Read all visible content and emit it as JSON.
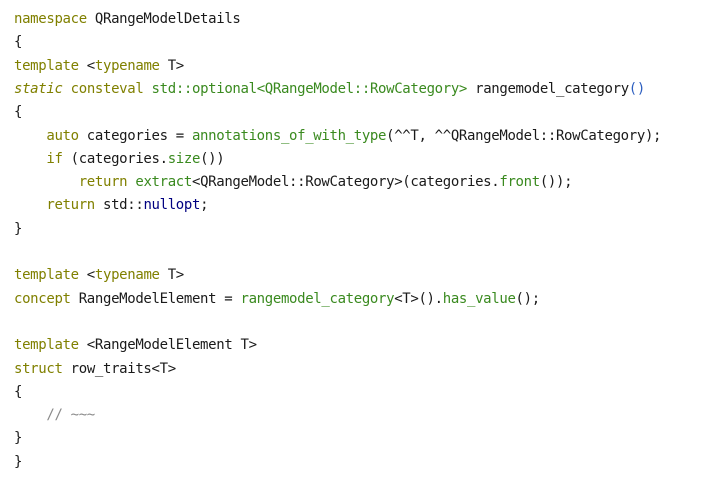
{
  "editor": {
    "background": "#ffffff",
    "colors": {
      "default_text": "#1a1a1a",
      "keyword": "#808000",
      "function_call": "#3a8a1f",
      "parentheses_highlight": "#2d5fc0",
      "constant": "#000080",
      "comment": "#8a8a8a"
    },
    "lines": [
      [
        {
          "t": "namespace",
          "c": "keyword"
        },
        {
          "t": " QRangeModelDetails"
        }
      ],
      [
        {
          "t": "{"
        }
      ],
      [
        {
          "t": "template",
          "c": "keyword"
        },
        {
          "t": " <"
        },
        {
          "t": "typename",
          "c": "keyword"
        },
        {
          "t": " T>"
        }
      ],
      [
        {
          "t": "static",
          "c": "keyword italic"
        },
        {
          "t": " "
        },
        {
          "t": "consteval",
          "c": "keyword"
        },
        {
          "t": " "
        },
        {
          "t": "std::optional<QRangeModel::RowCategory>",
          "c": "function"
        },
        {
          "t": " rangemodel_category"
        },
        {
          "t": "()",
          "c": "blue"
        }
      ],
      [
        {
          "t": "{"
        }
      ],
      [
        {
          "t": "    "
        },
        {
          "t": "auto",
          "c": "keyword"
        },
        {
          "t": " categories = "
        },
        {
          "t": "annotations_of_with_type",
          "c": "function"
        },
        {
          "t": "(^^T, ^^QRangeModel::RowCategory);"
        }
      ],
      [
        {
          "t": "    "
        },
        {
          "t": "if",
          "c": "keyword"
        },
        {
          "t": " (categories."
        },
        {
          "t": "size",
          "c": "function"
        },
        {
          "t": "())"
        }
      ],
      [
        {
          "t": "        "
        },
        {
          "t": "return",
          "c": "keyword"
        },
        {
          "t": " "
        },
        {
          "t": "extract",
          "c": "function"
        },
        {
          "t": "<QRangeModel::RowCategory>(categories."
        },
        {
          "t": "front",
          "c": "function"
        },
        {
          "t": "());"
        }
      ],
      [
        {
          "t": "    "
        },
        {
          "t": "return",
          "c": "keyword"
        },
        {
          "t": " std::"
        },
        {
          "t": "nullopt",
          "c": "navy"
        },
        {
          "t": ";"
        }
      ],
      [
        {
          "t": "}"
        }
      ],
      [],
      [
        {
          "t": "template",
          "c": "keyword"
        },
        {
          "t": " <"
        },
        {
          "t": "typename",
          "c": "keyword"
        },
        {
          "t": " T>"
        }
      ],
      [
        {
          "t": "concept",
          "c": "keyword"
        },
        {
          "t": " RangeModelElement = "
        },
        {
          "t": "rangemodel_category",
          "c": "function"
        },
        {
          "t": "<T>()."
        },
        {
          "t": "has_value",
          "c": "function"
        },
        {
          "t": "();"
        }
      ],
      [],
      [
        {
          "t": "template",
          "c": "keyword"
        },
        {
          "t": " <RangeModelElement T>"
        }
      ],
      [
        {
          "t": "struct",
          "c": "keyword"
        },
        {
          "t": " row_traits<T>"
        }
      ],
      [
        {
          "t": "{"
        }
      ],
      [
        {
          "t": "    "
        },
        {
          "t": "// ~~~",
          "c": "comment"
        }
      ],
      [
        {
          "t": "}"
        }
      ],
      [
        {
          "t": "}"
        }
      ]
    ]
  }
}
